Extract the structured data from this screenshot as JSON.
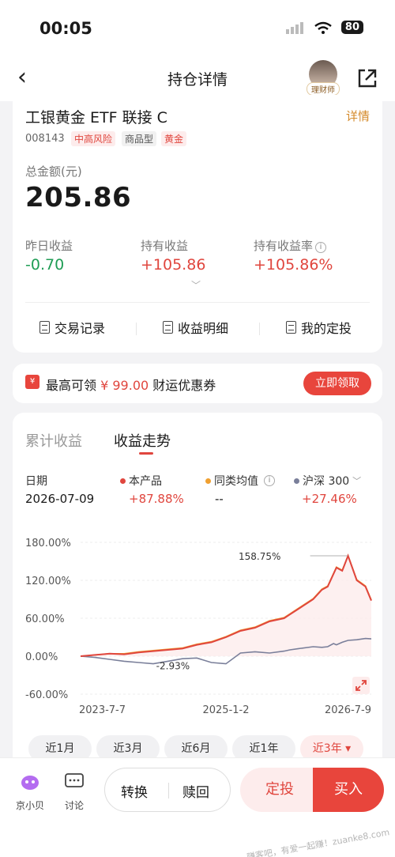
{
  "status": {
    "time": "00:05",
    "battery": "80"
  },
  "nav": {
    "title": "持仓详情",
    "advisor_badge": "理财师"
  },
  "fund": {
    "name": "工银黄金 ETF 联接 C",
    "detail_link": "详情",
    "code": "008143",
    "tags": [
      "中高风险",
      "商品型",
      "黄金"
    ],
    "total_label": "总金额(元)",
    "total_value": "205.86",
    "metrics": [
      {
        "label": "昨日收益",
        "value": "-0.70"
      },
      {
        "label": "持有收益",
        "value": "+105.86"
      },
      {
        "label": "持有收益率",
        "value": "+105.86%"
      }
    ],
    "actions": [
      "交易记录",
      "收益明细",
      "我的定投"
    ]
  },
  "coupon": {
    "prefix": "最高可领",
    "amount": "¥ 99.00",
    "suffix": "财运优惠券",
    "button": "立即领取"
  },
  "chart_section": {
    "tabs": [
      "累计收益",
      "收益走势"
    ],
    "active_tab": "收益走势",
    "date_label": "日期",
    "date_value": "2026-07-09",
    "legend": [
      {
        "name": "本产品",
        "value": "+87.88%",
        "color": "#e0463e"
      },
      {
        "name": "同类均值",
        "value": "--",
        "color": "#f0a030"
      },
      {
        "name": "沪深 300",
        "value": "+27.46%",
        "color": "#7a7f9a"
      }
    ],
    "annotations": {
      "peak": "158.75%",
      "low": "-2.93%"
    },
    "periods": [
      "近1月",
      "近3月",
      "近6月",
      "近1年",
      "近3年"
    ],
    "active_period": "近3年"
  },
  "chart_data": {
    "type": "line",
    "ylabel": "",
    "yticks": [
      "180.00%",
      "120.00%",
      "60.00%",
      "0.00%",
      "-60.00%"
    ],
    "ylim": [
      -60,
      180
    ],
    "xticks": [
      "2023-7-7",
      "2025-1-2",
      "2026-7-9"
    ],
    "x": [
      0,
      0.05,
      0.1,
      0.15,
      0.2,
      0.25,
      0.3,
      0.35,
      0.4,
      0.45,
      0.5,
      0.55,
      0.6,
      0.65,
      0.7,
      0.72,
      0.75,
      0.8,
      0.83,
      0.85,
      0.87,
      0.88,
      0.9,
      0.92,
      0.95,
      0.98,
      1.0
    ],
    "series": [
      {
        "name": "本产品",
        "color": "#e0463e",
        "values": [
          0,
          2,
          4,
          3,
          6,
          8,
          10,
          12,
          18,
          22,
          30,
          40,
          45,
          55,
          60,
          66,
          75,
          90,
          105,
          110,
          130,
          140,
          135,
          158.75,
          120,
          110,
          87.88
        ]
      },
      {
        "name": "同类均值",
        "color": "#f0a030",
        "values": [
          0,
          2,
          4,
          4,
          7,
          9,
          11,
          13,
          19,
          23,
          31,
          41,
          46,
          56,
          61,
          67,
          76,
          91,
          106,
          111,
          131,
          141,
          136,
          159,
          121,
          111,
          89
        ]
      },
      {
        "name": "沪深 300",
        "color": "#7a7f9a",
        "values": [
          0,
          -2,
          -5,
          -8,
          -10,
          -12,
          -8,
          -4,
          -2.93,
          -10,
          -12,
          5,
          7,
          5,
          8,
          10,
          12,
          15,
          14,
          15,
          20,
          18,
          22,
          25,
          26,
          28,
          27.46
        ]
      }
    ],
    "legend_position": "top"
  },
  "bottom": {
    "assistant": "京小贝",
    "discuss": "讨论",
    "convert": "转换",
    "redeem": "赎回",
    "fixed": "定投",
    "buy": "买入",
    "watermark": "赚客吧，有爱一起赚！zuanke8.com"
  }
}
